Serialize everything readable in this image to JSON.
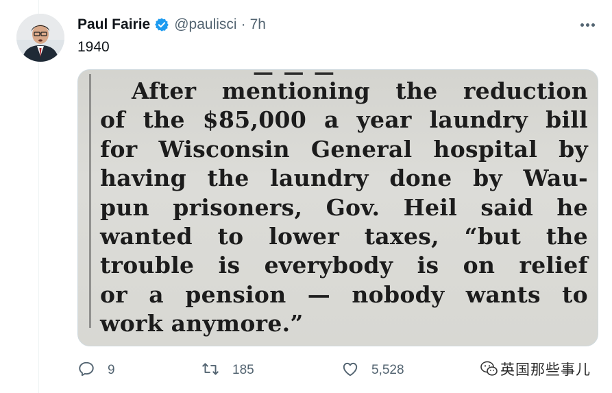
{
  "tweet": {
    "author_name": "Paul Fairie",
    "author_handle": "@paulisci",
    "separator": "·",
    "timestamp": "7h",
    "text": "1940",
    "verified": true
  },
  "media": {
    "type": "newspaper-clipping",
    "top_fragment": "— — —",
    "lines": [
      "After mentioning the reduction",
      "of the $85,000 a year laundry bill",
      "for Wisconsin General hospital by",
      "having the laundry done by Wau-",
      "pun prisoners, Gov. Heil said he",
      "wanted to lower taxes, “but the",
      "trouble is everybody is on relief",
      "or a pension — nobody wants to",
      "work anymore.”"
    ]
  },
  "actions": {
    "reply_count": "9",
    "retweet_count": "185",
    "like_count": "5,528"
  },
  "watermark": {
    "text": "英国那些事儿"
  },
  "colors": {
    "primary_text": "#0f1419",
    "secondary_text": "#536471",
    "verified_blue": "#1d9bf0",
    "border": "#cfd9de",
    "clipping_paper": "#d8d8d3"
  }
}
